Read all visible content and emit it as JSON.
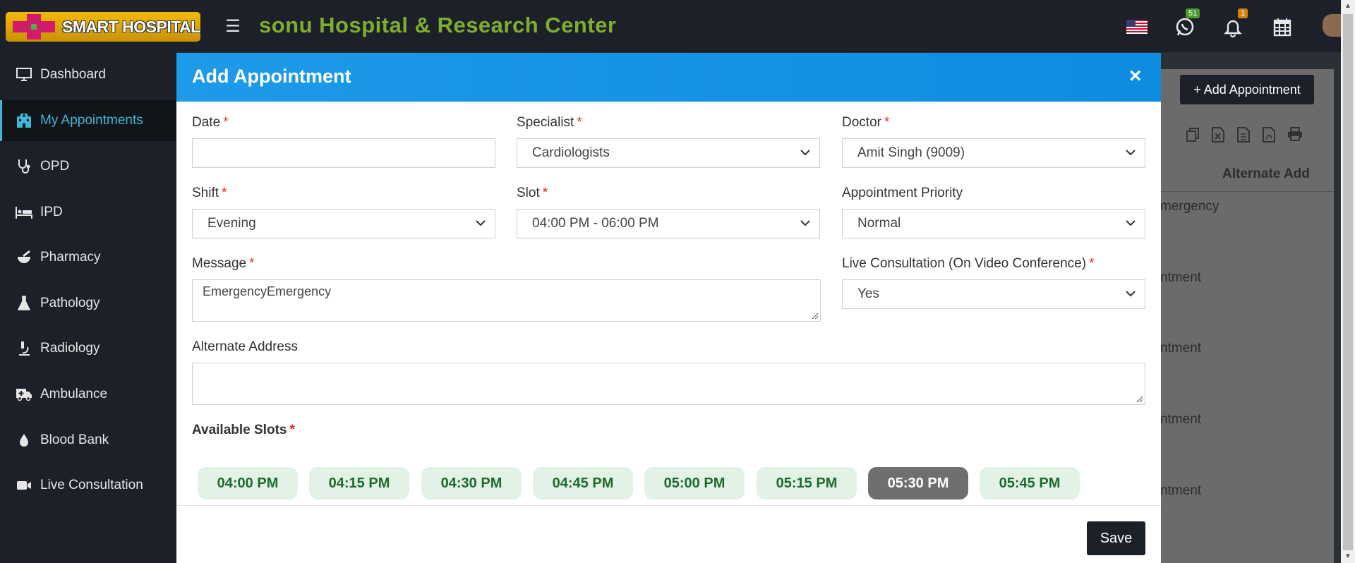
{
  "brand": {
    "logo_text": "SMART HOSPITAL",
    "hospital_name": "sonu Hospital & Research Center"
  },
  "topbar": {
    "whatsapp_badge": "51",
    "notification_badge": "1",
    "icons": [
      "menu-icon",
      "us-flag-icon",
      "whatsapp-icon",
      "bell-icon",
      "calendar-icon",
      "avatar"
    ]
  },
  "sidebar": {
    "items": [
      {
        "label": "Dashboard",
        "icon": "monitor-icon"
      },
      {
        "label": "My Appointments",
        "icon": "hospital-icon",
        "active": true
      },
      {
        "label": "OPD",
        "icon": "stethoscope-icon"
      },
      {
        "label": "IPD",
        "icon": "bed-icon"
      },
      {
        "label": "Pharmacy",
        "icon": "mortar-pestle-icon"
      },
      {
        "label": "Pathology",
        "icon": "flask-icon"
      },
      {
        "label": "Radiology",
        "icon": "microscope-icon"
      },
      {
        "label": "Ambulance",
        "icon": "ambulance-icon"
      },
      {
        "label": "Blood Bank",
        "icon": "blood-drop-icon"
      },
      {
        "label": "Live Consultation",
        "icon": "video-camera-icon"
      }
    ]
  },
  "background": {
    "add_button": "+ Add Appointment",
    "column_header": "Alternate Add",
    "cells": [
      "mergency",
      "ntment",
      "ntment",
      "ntment",
      "ntment"
    ]
  },
  "modal": {
    "title": "Add Appointment",
    "close": "×",
    "date": {
      "label": "Date",
      "value": ""
    },
    "specialist": {
      "label": "Specialist",
      "value": "Cardiologists"
    },
    "doctor": {
      "label": "Doctor",
      "value": "Amit Singh (9009)"
    },
    "shift": {
      "label": "Shift",
      "value": "Evening"
    },
    "slot": {
      "label": "Slot",
      "value": "04:00 PM - 06:00 PM"
    },
    "priority": {
      "label": "Appointment Priority",
      "value": "Normal"
    },
    "message": {
      "label": "Message",
      "value": "EmergencyEmergency"
    },
    "live": {
      "label": "Live Consultation (On Video Conference)",
      "value": "Yes"
    },
    "alternate_address": {
      "label": "Alternate Address",
      "value": ""
    },
    "available_slots": {
      "label": "Available Slots",
      "slots": [
        "04:00 PM",
        "04:15 PM",
        "04:30 PM",
        "04:45 PM",
        "05:00 PM",
        "05:15 PM",
        "05:30 PM",
        "05:45 PM"
      ],
      "selected": "05:30 PM"
    },
    "save": "Save",
    "required_mark": "*"
  },
  "colors": {
    "header_blue": "#1d9ae8",
    "sidebar_bg": "#1c2029",
    "brand_green": "#7fae2e",
    "slot_bg": "#e3f2e6",
    "slot_text": "#1d6b2c",
    "slot_selected": "#6f6f6f"
  }
}
